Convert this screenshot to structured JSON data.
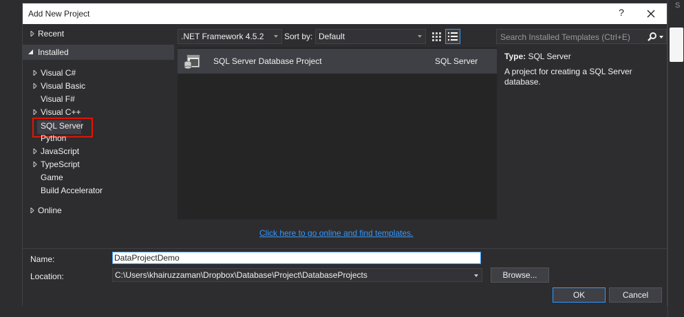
{
  "dialog": {
    "title": "Add New Project",
    "help_label": "?"
  },
  "tree": {
    "recent": "Recent",
    "installed": "Installed",
    "items": [
      {
        "label": "Visual C#",
        "expandable": true
      },
      {
        "label": "Visual Basic",
        "expandable": true
      },
      {
        "label": "Visual F#",
        "expandable": false
      },
      {
        "label": "Visual C++",
        "expandable": true
      },
      {
        "label": "SQL Server",
        "expandable": false,
        "selected": true
      },
      {
        "label": "Python",
        "expandable": false
      },
      {
        "label": "JavaScript",
        "expandable": true
      },
      {
        "label": "TypeScript",
        "expandable": true
      },
      {
        "label": "Game",
        "expandable": false
      },
      {
        "label": "Build Accelerator",
        "expandable": false
      }
    ],
    "online": "Online"
  },
  "toolbar": {
    "framework": ".NET Framework 4.5.2",
    "sort_label": "Sort by:",
    "sort_value": "Default",
    "search_placeholder": "Search Installed Templates (Ctrl+E)"
  },
  "templates": [
    {
      "name": "SQL Server Database Project",
      "language": "SQL Server",
      "icon": "database-project-icon"
    }
  ],
  "details": {
    "type_label": "Type:",
    "type_value": "SQL Server",
    "description": "A project for creating a SQL Server database."
  },
  "online_link": "Click here to go online and find templates.",
  "form": {
    "name_label": "Name:",
    "name_value": "DataProjectDemo",
    "location_label": "Location:",
    "location_value": "C:\\Users\\khairuzzaman\\Dropbox\\Database\\Project\\DatabaseProjects",
    "browse_label": "Browse...",
    "ok_label": "OK",
    "cancel_label": "Cancel"
  },
  "colors": {
    "accent": "#3399ff",
    "highlight": "#e51400",
    "background": "#2d2d30"
  }
}
